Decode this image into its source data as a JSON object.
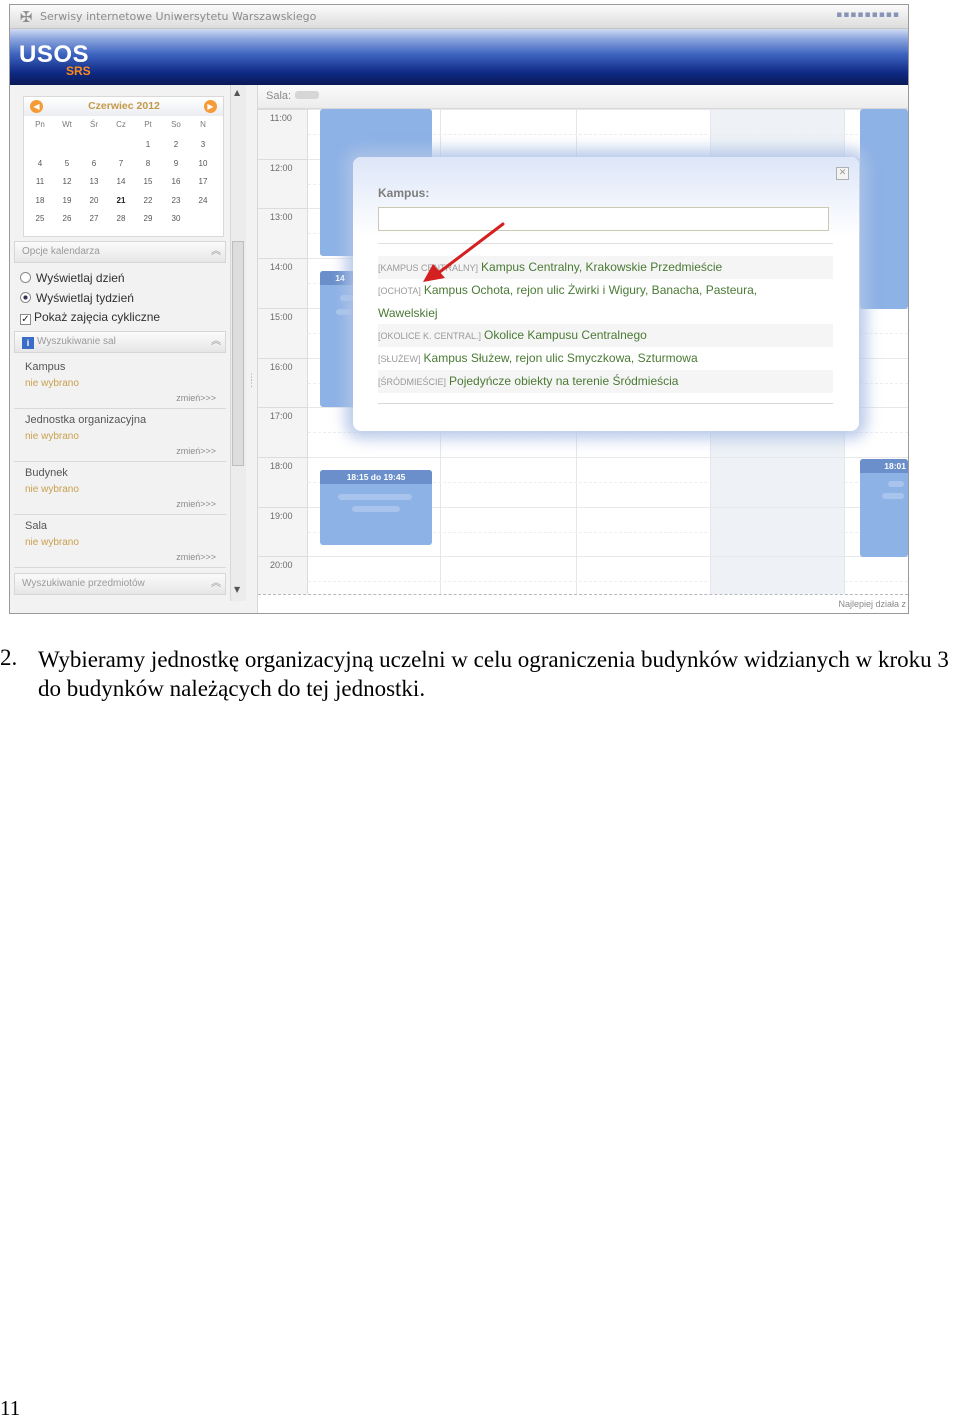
{
  "window": {
    "title": "Serwisy internetowe Uniwersytetu Warszawskiego",
    "dots": "▪▪▪▪▪▪▪▪▪"
  },
  "banner": {
    "logo": "USOS",
    "sublogo": "SRS"
  },
  "calendar": {
    "month_title": "Czerwiec 2012",
    "weekday_headers": [
      "Pn",
      "Wt",
      "Śr",
      "Cz",
      "Pt",
      "So",
      "N"
    ],
    "weeks": [
      [
        "",
        "",
        "",
        "",
        "1",
        "2",
        "3"
      ],
      [
        "4",
        "5",
        "6",
        "7",
        "8",
        "9",
        "10"
      ],
      [
        "11",
        "12",
        "13",
        "14",
        "15",
        "16",
        "17"
      ],
      [
        "18",
        "19",
        "20",
        "21",
        "22",
        "23",
        "24"
      ],
      [
        "25",
        "26",
        "27",
        "28",
        "29",
        "30",
        ""
      ]
    ],
    "today": "21"
  },
  "calendar_options": {
    "header": "Opcje kalendarza",
    "show_day": "Wyświetlaj dzień",
    "show_week": "Wyświetlaj tydzień",
    "show_cyclic": "Pokaż zajęcia cykliczne",
    "selected": "show_week",
    "cyclic_checked": true
  },
  "room_search": {
    "header": "Wyszukiwanie sal",
    "filters": [
      {
        "label": "Kampus",
        "value": "nie wybrano",
        "change": "zmień>>>"
      },
      {
        "label": "Jednostka organizacyjna",
        "value": "nie wybrano",
        "change": "zmień>>>"
      },
      {
        "label": "Budynek",
        "value": "nie wybrano",
        "change": "zmień>>>"
      },
      {
        "label": "Sala",
        "value": "nie wybrano",
        "change": "zmień>>>"
      }
    ]
  },
  "subject_search": {
    "header": "Wyszukiwanie przedmiotów"
  },
  "schedule": {
    "sala_label": "Sala:",
    "times": [
      "11:00",
      "12:00",
      "13:00",
      "14:00",
      "15:00",
      "16:00",
      "17:00",
      "18:00",
      "19:00",
      "20:00"
    ],
    "events": [
      {
        "head": "14"
      },
      {
        "head": "18:15 do 19:45"
      },
      {
        "head": "18:01"
      }
    ],
    "footer_note": "Najlepiej działa z"
  },
  "kampus_popup": {
    "title": "Kampus:",
    "input_value": "",
    "options": [
      {
        "code": "[KAMPUS CENTRALNY]",
        "name": "Kampus Centralny, Krakowskie Przedmieście"
      },
      {
        "code": "[OCHOTA]",
        "name": "Kampus Ochota, rejon ulic Żwirki i Wigury, Banacha, Pasteura,",
        "name2": "Wawelskiej"
      },
      {
        "code": "[OKOLICE K. CENTRAL.]",
        "name": "Okolice Kampusu Centralnego"
      },
      {
        "code": "[SŁUŻEW]",
        "name": "Kampus Służew, rejon ulic Smyczkowa, Szturmowa"
      },
      {
        "code": "[ŚRÓDMIEŚCIE]",
        "name": "Pojedyńcze obiekty na terenie Śródmieścia"
      }
    ]
  },
  "caption": {
    "number": "2.",
    "text": "Wybieramy jednostkę organizacyjną uczelni w celu ograniczenia budynków widzianych w kroku 3 do budynków należących do tej jednostki."
  },
  "page_number": "11",
  "colors": {
    "accent_orange": "#ff8a18",
    "banner_blue": "#0f2a84",
    "link_green": "#4a7a34",
    "arrow_red": "#d42020"
  }
}
